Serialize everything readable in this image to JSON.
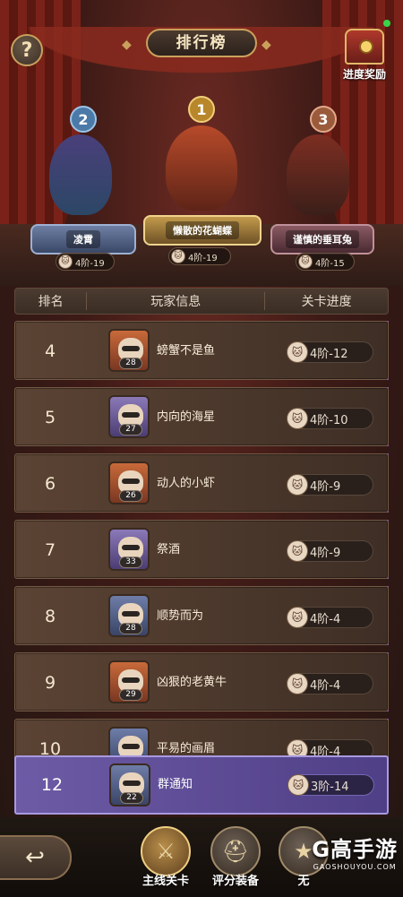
{
  "header": {
    "title": "排行榜",
    "help_label": "?",
    "reward_label": "进度奖励"
  },
  "podium": [
    {
      "rank": "2",
      "name": "凌霄",
      "progress": "4阶-19"
    },
    {
      "rank": "1",
      "name": "懒散的花蝴蝶",
      "progress": "4阶-19"
    },
    {
      "rank": "3",
      "name": "谨慎的垂耳兔",
      "progress": "4阶-15"
    }
  ],
  "table": {
    "headers": [
      "排名",
      "玩家信息",
      "关卡进度"
    ]
  },
  "rows": [
    {
      "rank": "4",
      "name": "螃蟹不是鱼",
      "level": "28",
      "progress": "4阶-12"
    },
    {
      "rank": "5",
      "name": "内向的海星",
      "level": "27",
      "progress": "4阶-10"
    },
    {
      "rank": "6",
      "name": "动人的小虾",
      "level": "26",
      "progress": "4阶-9"
    },
    {
      "rank": "7",
      "name": "祭酒",
      "level": "33",
      "progress": "4阶-9"
    },
    {
      "rank": "8",
      "name": "顺势而为",
      "level": "28",
      "progress": "4阶-4"
    },
    {
      "rank": "9",
      "name": "凶狠的老黄牛",
      "level": "29",
      "progress": "4阶-4"
    },
    {
      "rank": "10",
      "name": "平易的画眉",
      "level": "",
      "progress": "4阶-4"
    }
  ],
  "self": {
    "rank": "12",
    "name": "群通知",
    "level": "22",
    "progress": "3阶-14"
  },
  "bottom_nav": {
    "back_icon": "↩",
    "items": [
      {
        "label": "主线关卡",
        "icon": "swords-icon"
      },
      {
        "label": "评分装备",
        "icon": "helmet-icon"
      },
      {
        "label": "无",
        "icon": "star-icon"
      }
    ]
  },
  "watermark": {
    "logo": "G高手游",
    "url": "GAOSHOUYOU.COM"
  },
  "colors": {
    "accent_gold": "#c9a15d",
    "self_row": "#6d5ba6",
    "row_bg": "#5b4334"
  }
}
